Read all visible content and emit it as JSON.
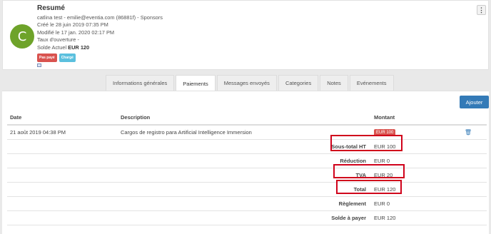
{
  "header": {
    "avatar_letter": "C",
    "title": "Resumé",
    "contact_line": "catlina test - emilie@eventia.com (86881f) - Sponsors",
    "created": "Créé le 28 juin 2019 07:35 PM",
    "modified": "Modifié le 17 jan. 2020 02:17 PM",
    "open_rate": "Taux d'ouverture -",
    "balance_label": "Solde Actuel",
    "balance_value": "EUR 120",
    "badges": {
      "unpaid": "Pas payé",
      "charged": "Chargé"
    },
    "menu_icon": "⋮"
  },
  "tabs": [
    {
      "label": "Informations générales",
      "active": false
    },
    {
      "label": "Paiements",
      "active": true
    },
    {
      "label": "Messages envoyés",
      "active": false
    },
    {
      "label": "Categories",
      "active": false
    },
    {
      "label": "Notes",
      "active": false
    },
    {
      "label": "Evénements",
      "active": false
    }
  ],
  "payments": {
    "add_button": "Ajouter",
    "columns": {
      "date": "Date",
      "description": "Description",
      "amount": "Montant"
    },
    "row": {
      "date": "21 août 2019 04:38 PM",
      "description": "Cargos de registro para Artificial Intelligence Immersion",
      "amount": "EUR 100",
      "delete_icon": "🗑"
    },
    "summary": [
      {
        "label": "Sous-total HT",
        "value": "EUR 100"
      },
      {
        "label": "Réduction",
        "value": "EUR 0"
      },
      {
        "label": "TVA",
        "value": "EUR 20"
      },
      {
        "label": "Total",
        "value": "EUR 120"
      },
      {
        "label": "Règlement",
        "value": "EUR 0"
      },
      {
        "label": "Solde à payer",
        "value": "EUR 120"
      }
    ]
  },
  "colors": {
    "accent": "#337ab7",
    "avatar": "#6ea32a",
    "danger": "#d9534f",
    "info": "#5bc0de",
    "highlight": "#d0021b"
  }
}
